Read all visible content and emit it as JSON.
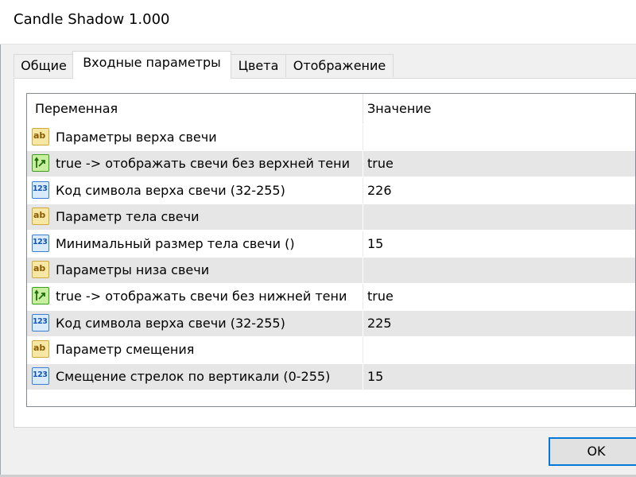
{
  "window": {
    "title": "Candle Shadow 1.000"
  },
  "tabs": [
    {
      "label": "Общие",
      "active": false
    },
    {
      "label": "Входные параметры",
      "active": true
    },
    {
      "label": "Цвета",
      "active": false
    },
    {
      "label": "Отображение",
      "active": false
    }
  ],
  "grid": {
    "columns": {
      "variable": "Переменная",
      "value": "Значение"
    },
    "rows": [
      {
        "icon": "string-icon",
        "glyph": "ab",
        "label": "Параметры верха свечи",
        "value": ""
      },
      {
        "icon": "bool-icon",
        "glyph": "",
        "label": "true -> отображать свечи без верхней тени",
        "value": "true"
      },
      {
        "icon": "integer-icon",
        "glyph": "123",
        "label": "Код символа верха свечи (32-255)",
        "value": "226"
      },
      {
        "icon": "string-icon",
        "glyph": "ab",
        "label": "Параметр тела свечи",
        "value": ""
      },
      {
        "icon": "integer-icon",
        "glyph": "123",
        "label": "Минимальный размер тела свечи ()",
        "value": "15"
      },
      {
        "icon": "string-icon",
        "glyph": "ab",
        "label": "Параметры низа свечи",
        "value": ""
      },
      {
        "icon": "bool-icon",
        "glyph": "",
        "label": "true -> отображать свечи без нижней тени",
        "value": "true"
      },
      {
        "icon": "integer-icon",
        "glyph": "123",
        "label": "Код символа верха свечи (32-255)",
        "value": "225"
      },
      {
        "icon": "string-icon",
        "glyph": "ab",
        "label": "Параметр смещения",
        "value": ""
      },
      {
        "icon": "integer-icon",
        "glyph": "123",
        "label": "Смещение стрелок по вертикали (0-255)",
        "value": "15"
      }
    ]
  },
  "buttons": {
    "ok": "OK"
  },
  "colors": {
    "accent": "#0078d7",
    "alt_row": "#e6e6e6",
    "grid_border": "#828790"
  }
}
